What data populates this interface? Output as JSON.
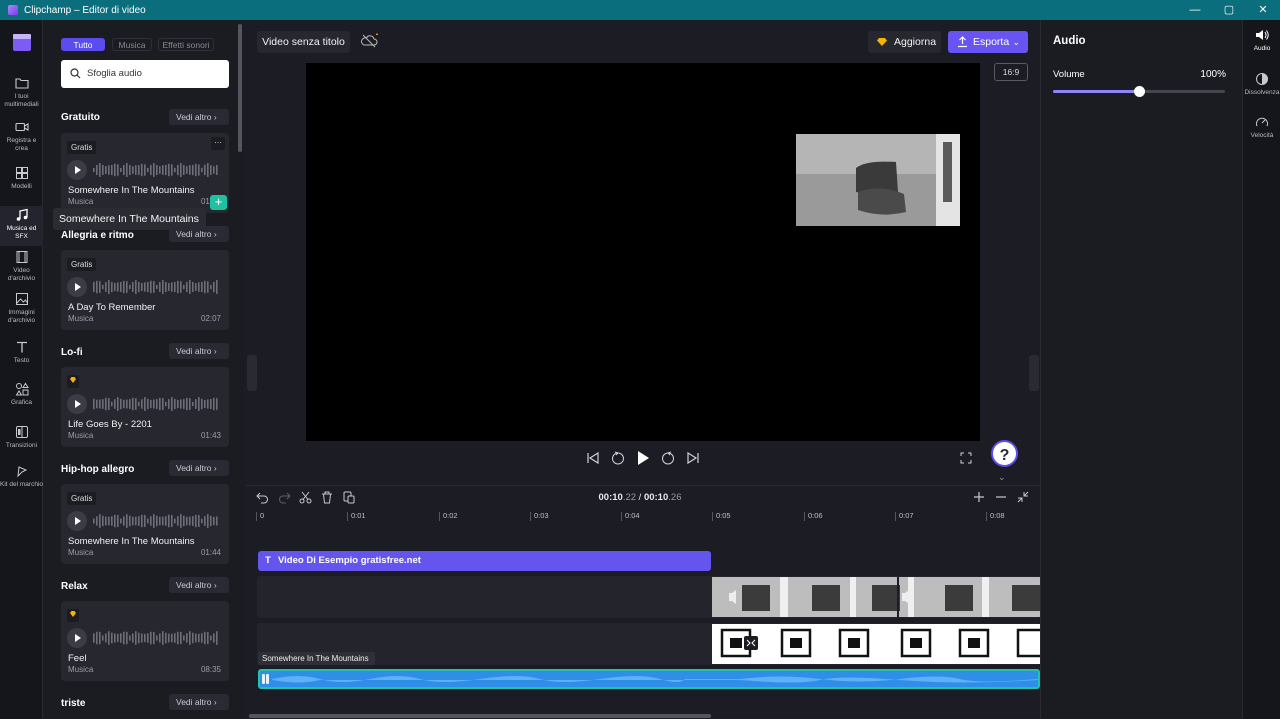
{
  "window": {
    "title": "Clipchamp – Editor di video",
    "controls": [
      "—",
      "▢",
      "✕"
    ]
  },
  "rail": [
    {
      "label": "I tuoi multimediali",
      "icon": "folder-icon"
    },
    {
      "label": "Registra e crea",
      "icon": "camera-icon"
    },
    {
      "label": "Modelli",
      "icon": "templates-icon"
    },
    {
      "label": "Musica ed SFX",
      "icon": "music-icon",
      "active": true
    },
    {
      "label": "Video d'archivio",
      "icon": "film-icon"
    },
    {
      "label": "Immagini d'archivio",
      "icon": "image-icon"
    },
    {
      "label": "Testo",
      "icon": "text-icon"
    },
    {
      "label": "Grafica",
      "icon": "shapes-icon"
    },
    {
      "label": "Transizioni",
      "icon": "transitions-icon"
    },
    {
      "label": "Kit del marchio",
      "icon": "brand-kit-icon"
    }
  ],
  "library": {
    "filters": [
      "Tutto",
      "Musica",
      "Effetti sonori"
    ],
    "search_placeholder": "Sfoglia audio",
    "see_more": "Vedi altro",
    "sections": [
      {
        "title": "Gratuito",
        "card": {
          "badge": "Gratis",
          "title": "Somewhere In The Mountains",
          "type": "Musica",
          "duration": "01:44"
        }
      },
      {
        "title": "Allegria e ritmo",
        "card": {
          "badge": "Gratis",
          "title": "A Day To Remember",
          "type": "Musica",
          "duration": "02:07"
        }
      },
      {
        "title": "Lo-fi",
        "card": {
          "badge": "",
          "premium": true,
          "title": "Life Goes By - 2201",
          "type": "Musica",
          "duration": "01:43"
        }
      },
      {
        "title": "Hip-hop allegro",
        "card": {
          "badge": "Gratis",
          "title": "Somewhere In The Mountains",
          "type": "Musica",
          "duration": "01:44"
        }
      },
      {
        "title": "Relax",
        "card": {
          "badge": "",
          "premium": true,
          "title": "Feel",
          "type": "Musica",
          "duration": "08:35"
        }
      },
      {
        "title": "triste"
      }
    ],
    "tooltip": "Somewhere In The Mountains",
    "more_menu": "···"
  },
  "topbar": {
    "project_name": "Video senza titolo",
    "upgrade": "Aggiorna",
    "export": "Esporta"
  },
  "preview": {
    "ratio": "16:9",
    "help": "?"
  },
  "timeline": {
    "timecode_current": "00:10",
    "timecode_current_frac": ".22",
    "timecode_total": "00:10",
    "timecode_total_frac": ".26",
    "sep": " / ",
    "ruler": [
      "0",
      "0:01",
      "0:02",
      "0:03",
      "0:04",
      "0:05",
      "0:06",
      "0:07",
      "0:08"
    ],
    "text_clip": "Video Di Esempio gratisfree.net",
    "audio_clip": "Somewhere In The Mountains"
  },
  "properties": {
    "title": "Audio",
    "volume_label": "Volume",
    "volume_value": "100%",
    "volume_fraction": 0.5
  },
  "right_rail": [
    {
      "label": "Audio",
      "icon": "speaker-icon",
      "active": true
    },
    {
      "label": "Dissolvenza",
      "icon": "fade-icon"
    },
    {
      "label": "Velocità",
      "icon": "speed-icon"
    }
  ]
}
